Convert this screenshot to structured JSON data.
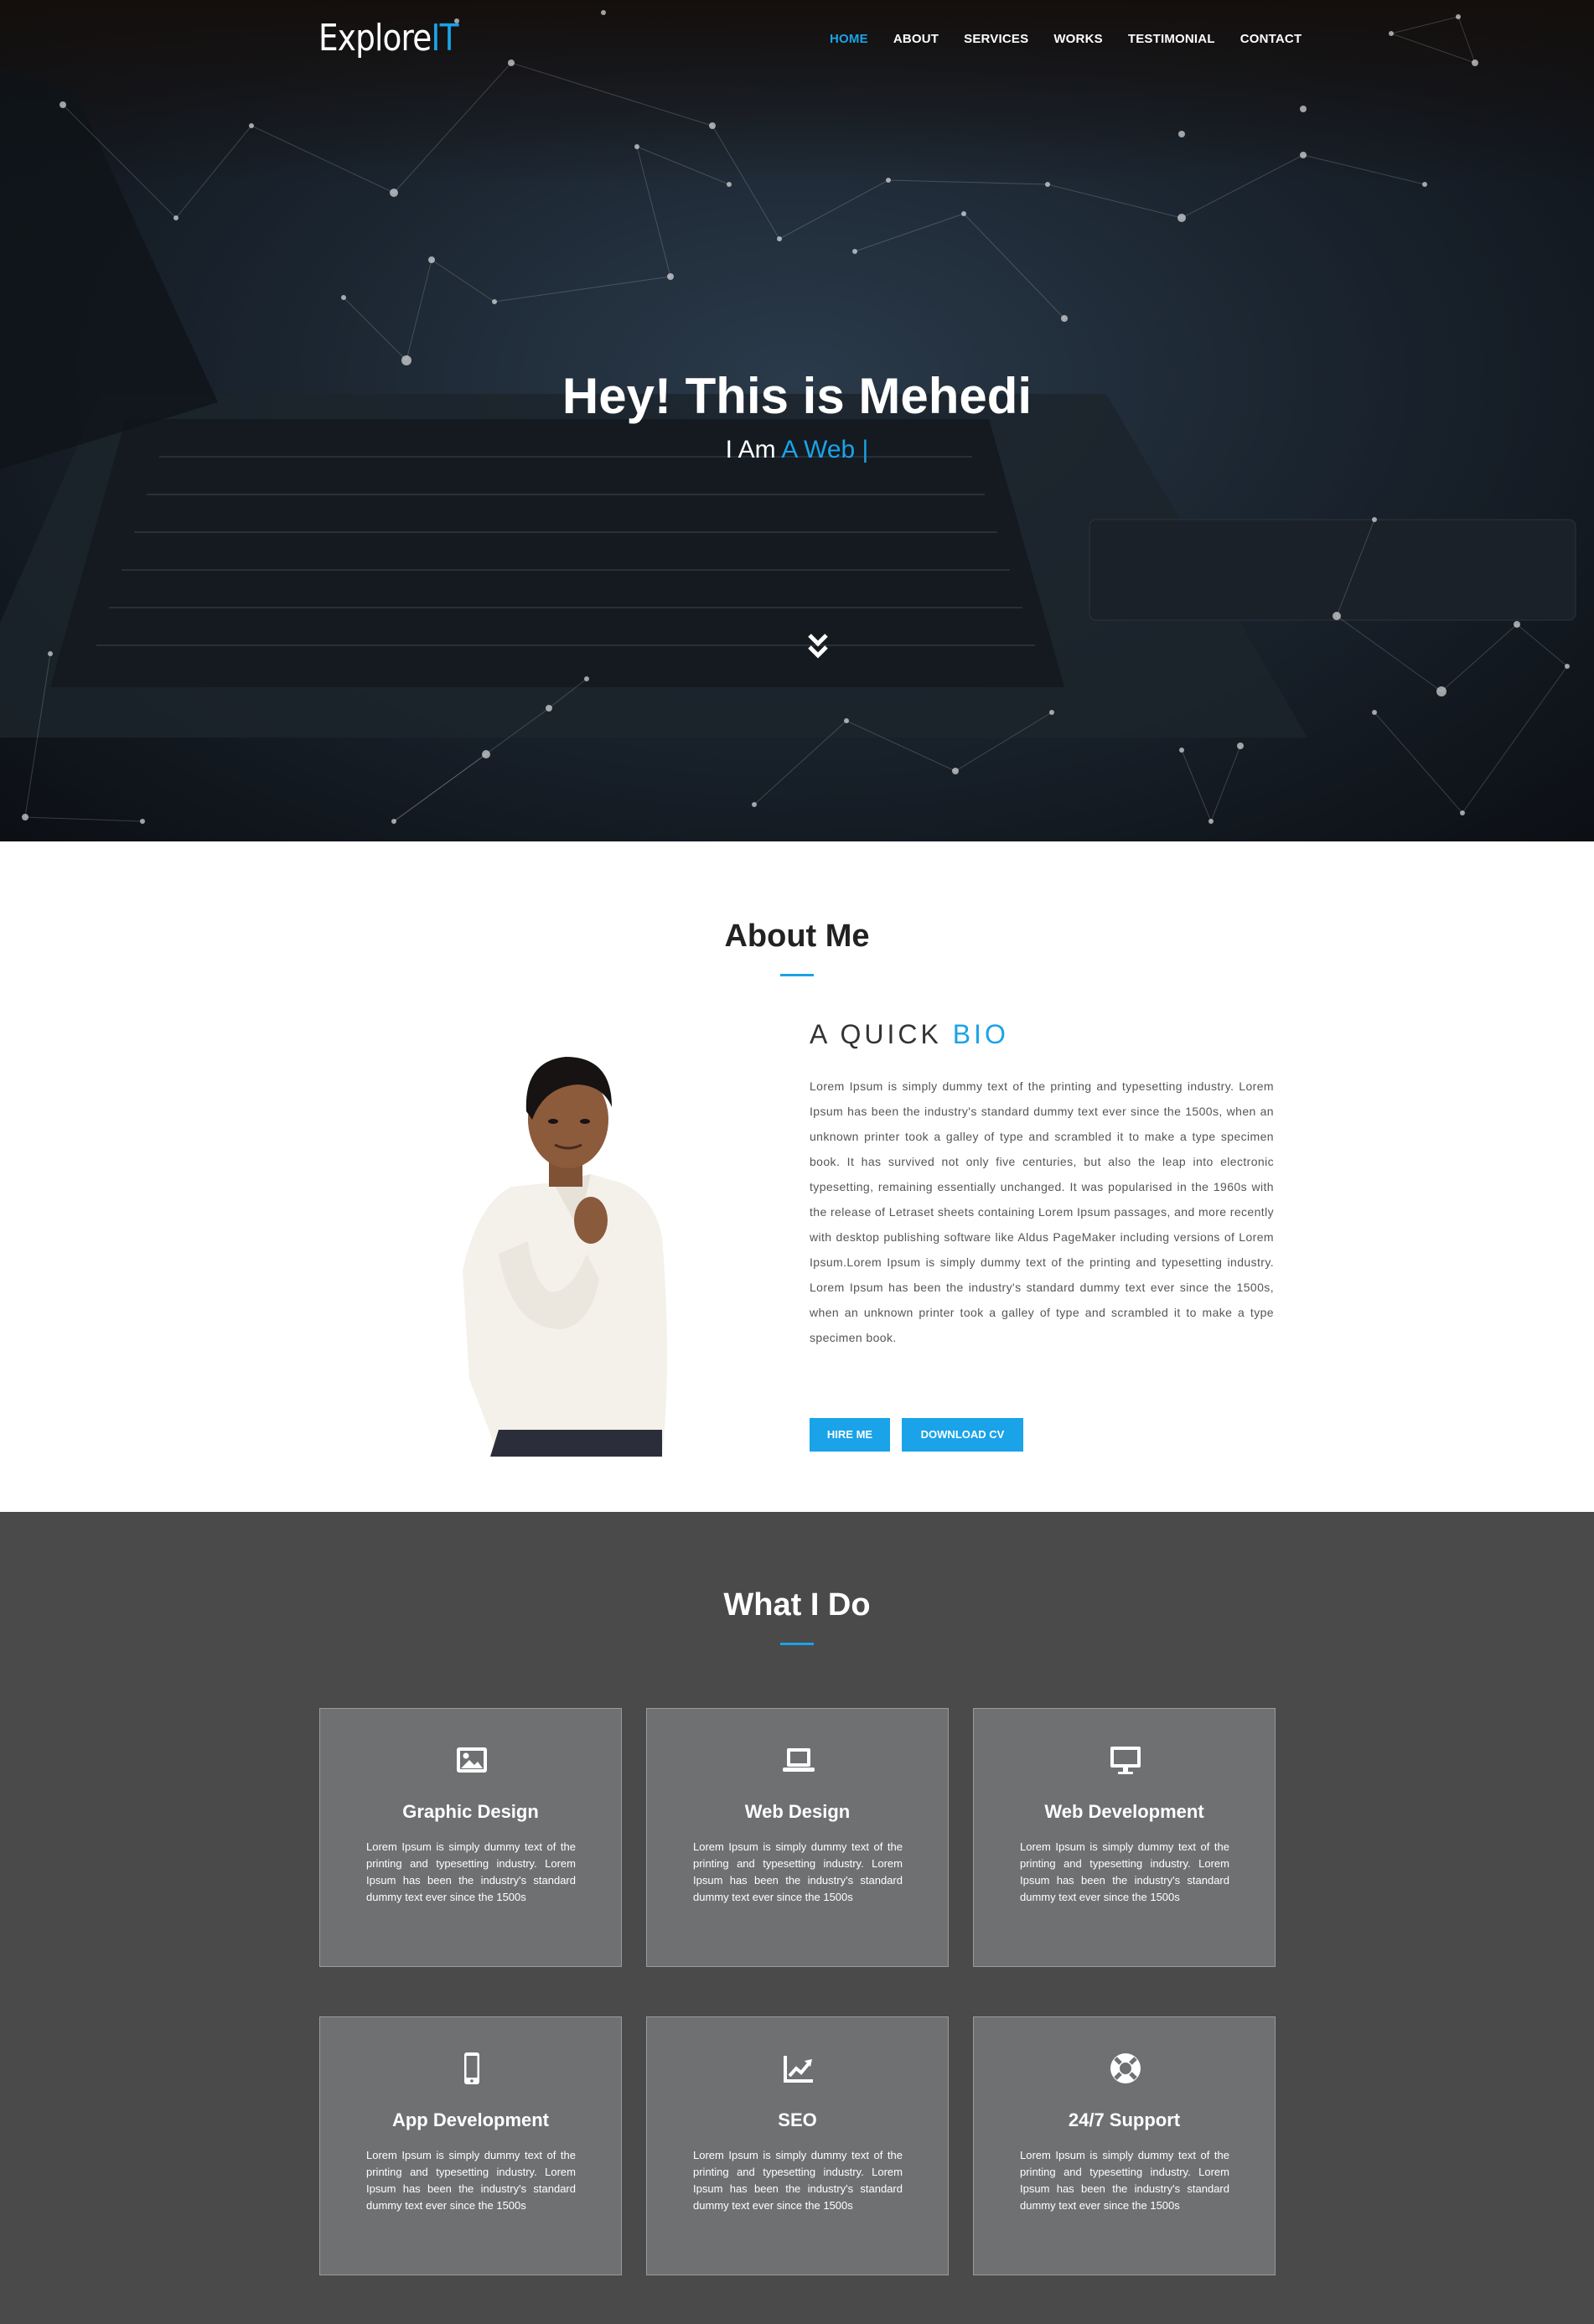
{
  "header": {
    "logo_main": "Explore",
    "logo_accent": "IT",
    "nav": [
      "HOME",
      "ABOUT",
      "SERVICES",
      "WORKS",
      "TESTIMONIAL",
      "CONTACT"
    ],
    "active_nav": "HOME"
  },
  "hero": {
    "title": "Hey! This is Mehedi",
    "subtitle_prefix": "I Am",
    "subtitle_accent": "A Web |",
    "scroll_icon": "double-chevron-down-icon"
  },
  "about": {
    "title": "About Me",
    "bio_heading_prefix": "A QUICK",
    "bio_heading_accent": "BIO",
    "bio_text": "Lorem Ipsum is simply dummy text of the printing and typesetting industry. Lorem Ipsum has been the industry's standard dummy text ever since the 1500s, when an unknown printer took a galley of type and scrambled it to make a type specimen book. It has survived not only five centuries, but also the leap into electronic typesetting, remaining essentially unchanged. It was popularised in the 1960s with the release of Letraset sheets containing Lorem Ipsum passages, and more recently with desktop publishing software like Aldus PageMaker including versions of Lorem Ipsum.Lorem Ipsum is simply dummy text of the printing and typesetting industry. Lorem Ipsum has been the industry's standard dummy text ever since the 1500s, when an unknown printer took a galley of type and scrambled it to make a type specimen book.",
    "hire_button": "HIRE ME",
    "cv_button": "DOWNLOAD CV"
  },
  "services": {
    "title": "What I Do",
    "items": [
      {
        "title": "Graphic Design",
        "icon": "image-icon",
        "desc": "Lorem Ipsum is simply dummy text of the printing and typesetting industry. Lorem Ipsum has been the industry's standard dummy text ever since the 1500s"
      },
      {
        "title": "Web Design",
        "icon": "laptop-icon",
        "desc": "Lorem Ipsum is simply dummy text of the printing and typesetting industry. Lorem Ipsum has been the industry's standard dummy text ever since the 1500s"
      },
      {
        "title": "Web Development",
        "icon": "desktop-icon",
        "desc": "Lorem Ipsum is simply dummy text of the printing and typesetting industry. Lorem Ipsum has been the industry's standard dummy text ever since the 1500s"
      },
      {
        "title": "App Development",
        "icon": "mobile-icon",
        "desc": "Lorem Ipsum is simply dummy text of the printing and typesetting industry. Lorem Ipsum has been the industry's standard dummy text ever since the 1500s"
      },
      {
        "title": "SEO",
        "icon": "chart-line-icon",
        "desc": "Lorem Ipsum is simply dummy text of the printing and typesetting industry. Lorem Ipsum has been the industry's standard dummy text ever since the 1500s"
      },
      {
        "title": "24/7 Support",
        "icon": "lifebuoy-icon",
        "desc": "Lorem Ipsum is simply dummy text of the printing and typesetting industry. Lorem Ipsum has been the industry's standard dummy text ever since the 1500s"
      }
    ]
  },
  "colors": {
    "accent": "#1aa3e8",
    "services_bg": "#4a4a4a",
    "card_bg": "#6f7072"
  }
}
